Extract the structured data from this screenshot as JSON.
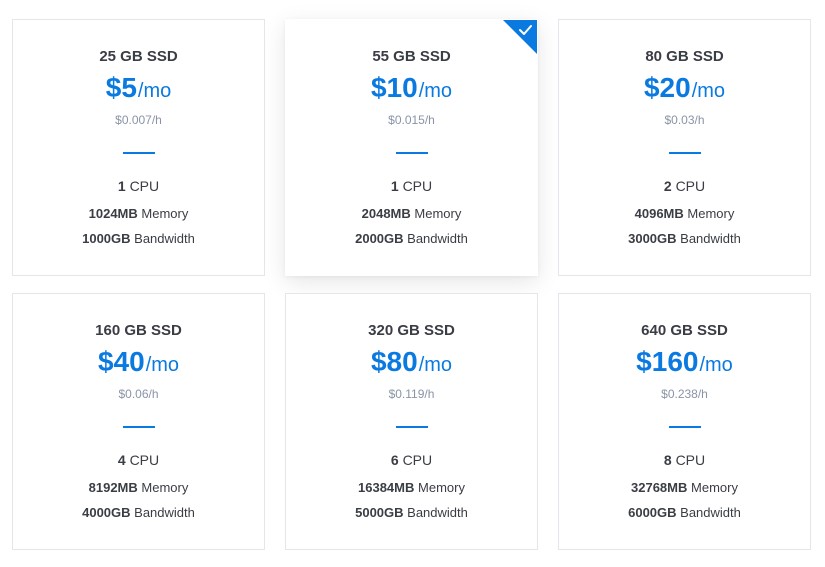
{
  "plans": [
    {
      "storage": "25 GB SSD",
      "price": "$5",
      "per": "/mo",
      "hourly": "$0.007/h",
      "cpu_count": "1",
      "cpu_label": "CPU",
      "memory_value": "1024MB",
      "memory_label": "Memory",
      "bandwidth_value": "1000GB",
      "bandwidth_label": "Bandwidth",
      "selected": false
    },
    {
      "storage": "55 GB SSD",
      "price": "$10",
      "per": "/mo",
      "hourly": "$0.015/h",
      "cpu_count": "1",
      "cpu_label": "CPU",
      "memory_value": "2048MB",
      "memory_label": "Memory",
      "bandwidth_value": "2000GB",
      "bandwidth_label": "Bandwidth",
      "selected": true
    },
    {
      "storage": "80 GB SSD",
      "price": "$20",
      "per": "/mo",
      "hourly": "$0.03/h",
      "cpu_count": "2",
      "cpu_label": "CPU",
      "memory_value": "4096MB",
      "memory_label": "Memory",
      "bandwidth_value": "3000GB",
      "bandwidth_label": "Bandwidth",
      "selected": false
    },
    {
      "storage": "160 GB SSD",
      "price": "$40",
      "per": "/mo",
      "hourly": "$0.06/h",
      "cpu_count": "4",
      "cpu_label": "CPU",
      "memory_value": "8192MB",
      "memory_label": "Memory",
      "bandwidth_value": "4000GB",
      "bandwidth_label": "Bandwidth",
      "selected": false
    },
    {
      "storage": "320 GB SSD",
      "price": "$80",
      "per": "/mo",
      "hourly": "$0.119/h",
      "cpu_count": "6",
      "cpu_label": "CPU",
      "memory_value": "16384MB",
      "memory_label": "Memory",
      "bandwidth_value": "5000GB",
      "bandwidth_label": "Bandwidth",
      "selected": false
    },
    {
      "storage": "640 GB SSD",
      "price": "$160",
      "per": "/mo",
      "hourly": "$0.238/h",
      "cpu_count": "8",
      "cpu_label": "CPU",
      "memory_value": "32768MB",
      "memory_label": "Memory",
      "bandwidth_value": "6000GB",
      "bandwidth_label": "Bandwidth",
      "selected": false
    }
  ],
  "icons": {
    "selected_marker": "checkmark-icon"
  },
  "colors": {
    "accent": "#0b7ae0",
    "border": "#e3e6ea",
    "muted_text": "#8a94a6",
    "text": "#3a3d44"
  }
}
